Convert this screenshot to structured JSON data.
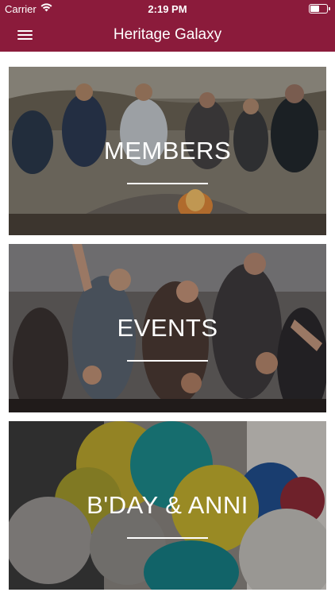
{
  "status_bar": {
    "carrier": "Carrier",
    "time": "2:19 PM"
  },
  "nav": {
    "title": "Heritage Galaxy"
  },
  "cards": [
    {
      "label": "MEMBERS"
    },
    {
      "label": "EVENTS"
    },
    {
      "label": "B'DAY & ANNI"
    }
  ],
  "colors": {
    "brand": "#8b1b3b",
    "text": "#ffffff",
    "background": "#ffffff"
  },
  "icons": {
    "menu": "hamburger-menu-icon",
    "wifi": "wifi-icon",
    "battery": "battery-icon"
  }
}
